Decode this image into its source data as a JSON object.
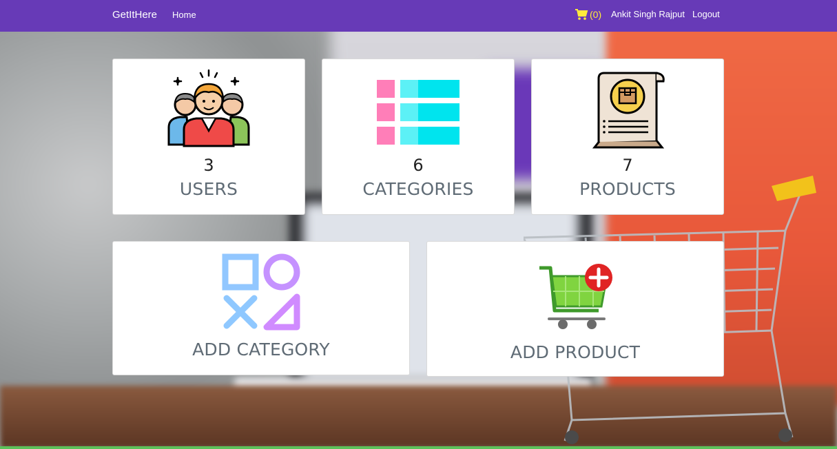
{
  "navbar": {
    "brand": "GetItHere",
    "home_label": "Home",
    "cart_count": "(0)",
    "user_name": "Ankit Singh Rajput",
    "logout_label": "Logout",
    "bg_color": "#673ab7",
    "cart_color": "#ffeb3b"
  },
  "stats": [
    {
      "count": "3",
      "label": "USERS",
      "icon": "users-group-icon"
    },
    {
      "count": "6",
      "label": "CATEGORIES",
      "icon": "list-categories-icon"
    },
    {
      "count": "7",
      "label": "PRODUCTS",
      "icon": "product-document-icon"
    }
  ],
  "actions": [
    {
      "label": "ADD CATEGORY",
      "icon": "shapes-icon"
    },
    {
      "label": "ADD PRODUCT",
      "icon": "cart-add-icon"
    }
  ]
}
